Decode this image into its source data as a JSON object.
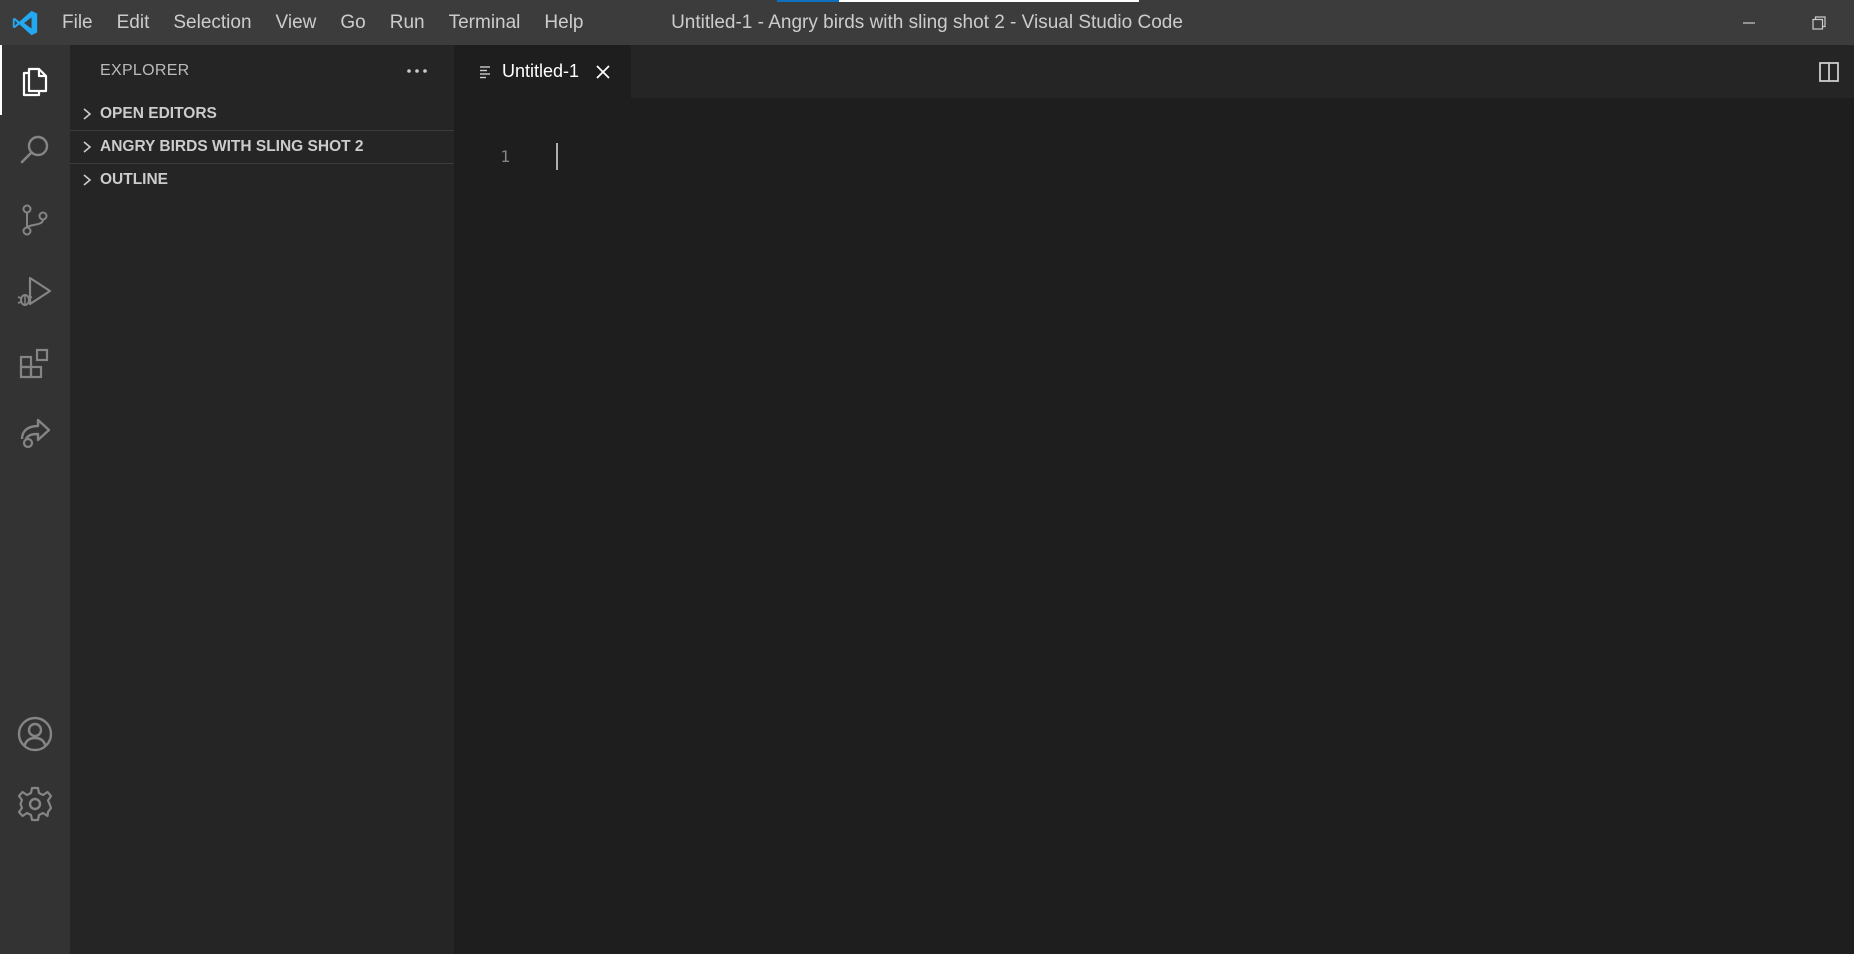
{
  "app": {
    "window_title": "Untitled-1 - Angry birds with sling shot 2 - Visual Studio Code",
    "accent_color": "#0e70c0",
    "progress": 0.17
  },
  "menu": [
    "File",
    "Edit",
    "Selection",
    "View",
    "Go",
    "Run",
    "Terminal",
    "Help"
  ],
  "activity_bar": {
    "items": [
      {
        "name": "explorer",
        "icon": "files-icon",
        "active": true
      },
      {
        "name": "search",
        "icon": "search-icon",
        "active": false
      },
      {
        "name": "source-control",
        "icon": "source-control-icon",
        "active": false
      },
      {
        "name": "run-and-debug",
        "icon": "run-debug-icon",
        "active": false
      },
      {
        "name": "extensions",
        "icon": "extensions-icon",
        "active": false
      },
      {
        "name": "live-share",
        "icon": "live-share-icon",
        "active": false
      }
    ],
    "bottom_items": [
      {
        "name": "accounts",
        "icon": "account-icon"
      },
      {
        "name": "manage",
        "icon": "gear-icon"
      }
    ]
  },
  "sidebar": {
    "title": "EXPLORER",
    "sections": [
      {
        "label": "OPEN EDITORS",
        "expanded": false
      },
      {
        "label": "ANGRY BIRDS WITH SLING SHOT 2",
        "expanded": false
      },
      {
        "label": "OUTLINE",
        "expanded": false
      }
    ]
  },
  "editor": {
    "tabs": [
      {
        "label": "Untitled-1",
        "icon": "text-file-icon",
        "active": true
      }
    ],
    "lines": [
      {
        "number": "1",
        "text": ""
      }
    ]
  }
}
